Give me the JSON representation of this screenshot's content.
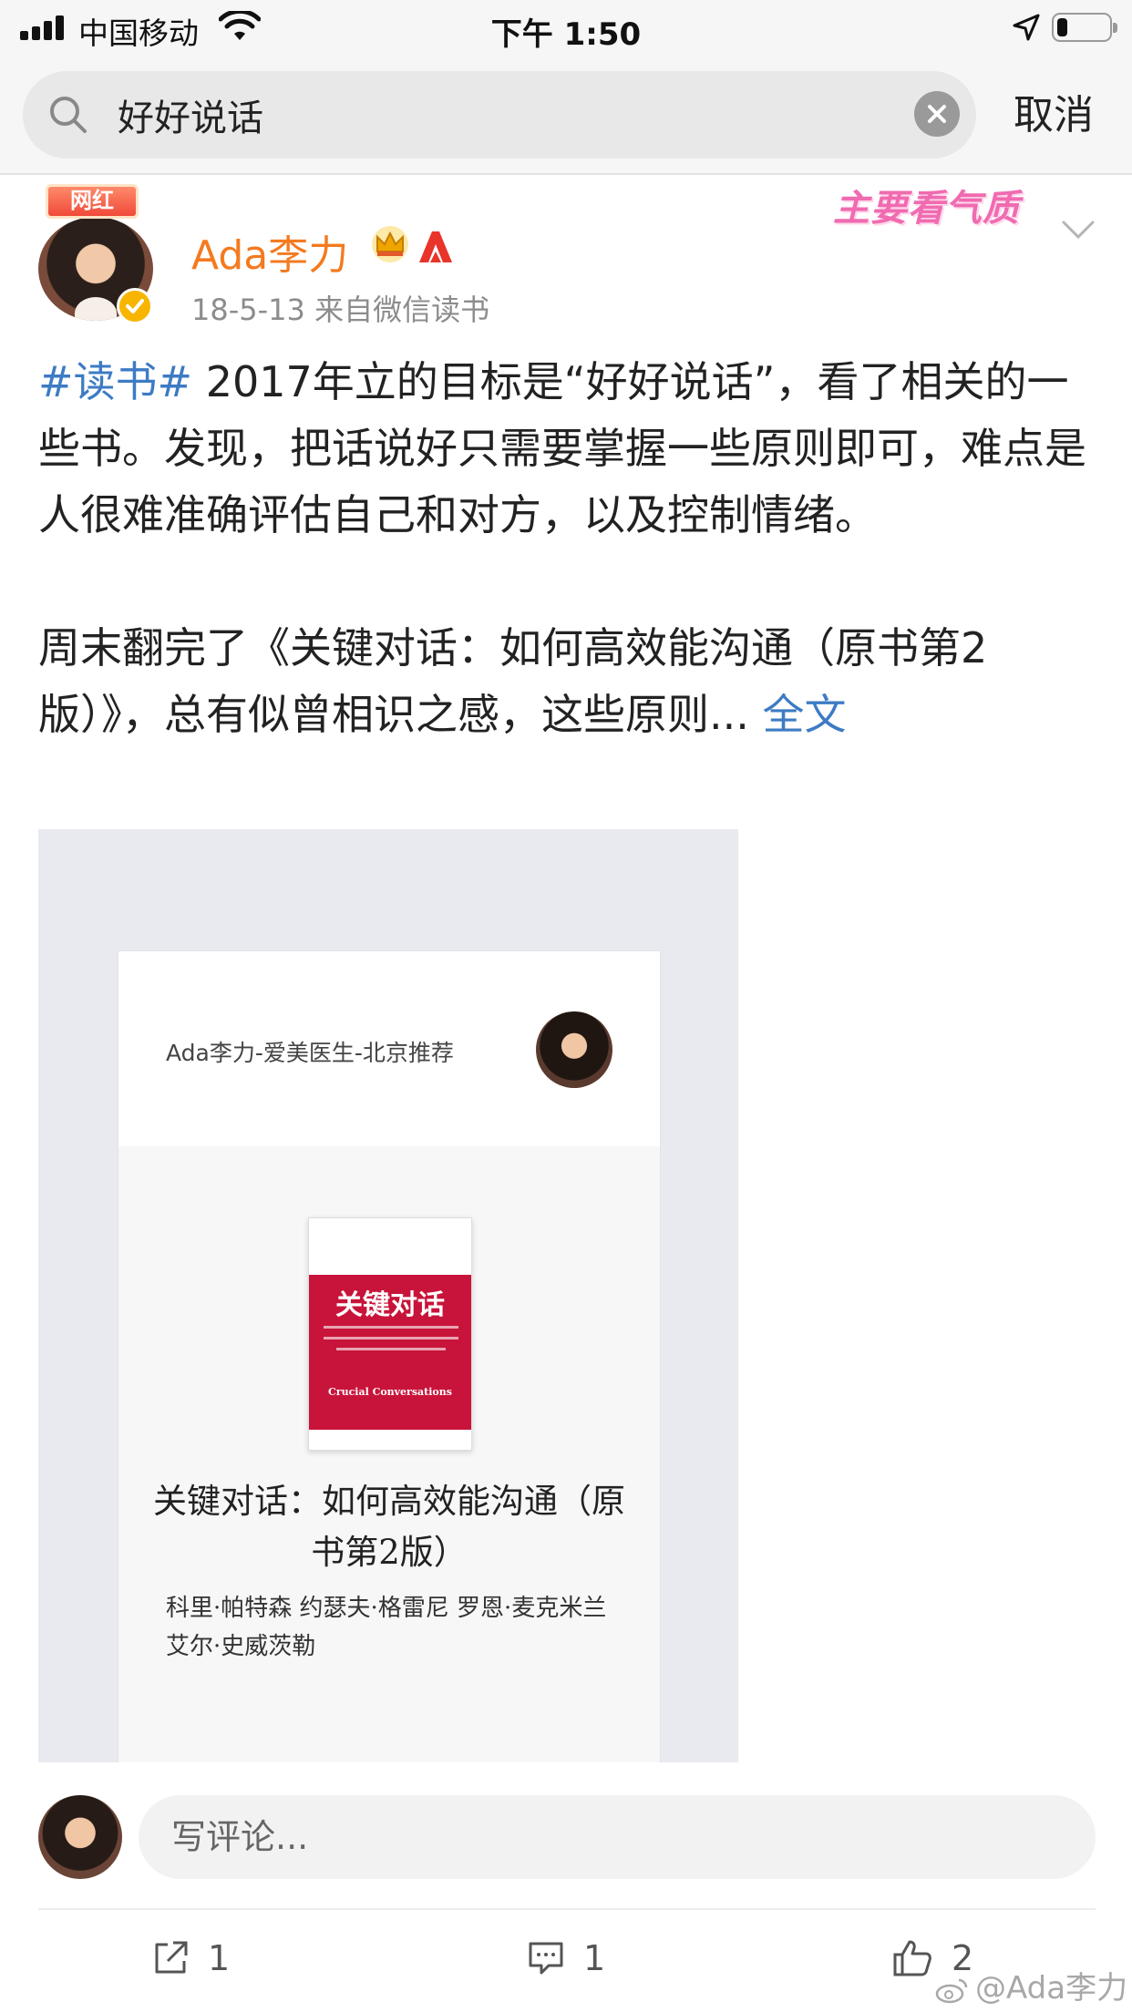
{
  "status_bar": {
    "carrier": "中国移动",
    "time": "下午 1:50",
    "signal_icon": "signal-icon",
    "wifi_icon": "wifi-icon",
    "location_icon": "location-arrow-icon",
    "battery_icon": "battery-icon",
    "battery_level": 0.2
  },
  "search": {
    "query": "好好说话",
    "cancel_label": "取消",
    "search_icon": "search-icon",
    "clear_icon": "clear-icon"
  },
  "post": {
    "author_badge": "网红",
    "author": "Ada李力",
    "date": "18-5-13",
    "source": "来自微信读书",
    "meta": "18-5-13  来自微信读书",
    "sticker": "主要看气质",
    "hashtag": "#读书#",
    "paragraph1_rest": " 2017年立的目标是“好好说话”，看了相关的一些书。发现，把话说好只需要掌握一些原则即可，难点是人很难准确评估自己和对方，以及控制情绪。",
    "paragraph2": "周末翻完了《关键对话：如何高效能沟通（原书第2版）》，总有似曾相识之感，这些原则...",
    "full_text_link": "全文"
  },
  "card": {
    "header": "Ada李力-爱美医生-北京推荐",
    "cover_title": "关键对话",
    "cover_subtitle": "Crucial Conversations",
    "book_title": "关键对话：如何高效能沟通（原书第2版）",
    "book_authors": "科里·帕特森 约瑟夫·格雷尼 罗恩·麦克米兰 艾尔·史威茨勒"
  },
  "comment": {
    "placeholder": "写评论..."
  },
  "actions": {
    "share_count": "1",
    "comment_count": "1",
    "like_count": "2"
  },
  "watermark": "@Ada李力",
  "colors": {
    "username": "#f47a1f",
    "link": "#3d7bc4",
    "book_red": "#c8143a"
  }
}
